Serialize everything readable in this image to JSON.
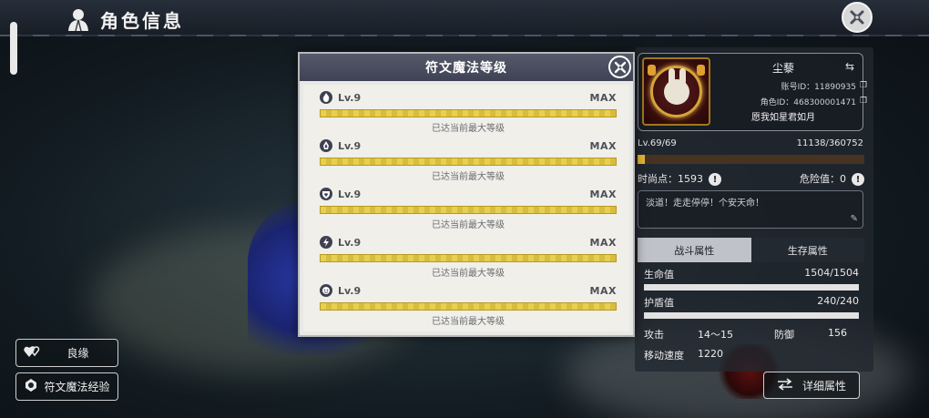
{
  "header": {
    "title": "角色信息"
  },
  "left_buttons": {
    "bond": "良缘",
    "rune_exp": "符文魔法经验"
  },
  "modal": {
    "title": "符文魔法等级",
    "runes": [
      {
        "level": "Lv.9",
        "max": "MAX",
        "progress": 1.0,
        "note": "已达当前最大等级",
        "icon": "flame-icon"
      },
      {
        "level": "Lv.9",
        "max": "MAX",
        "progress": 1.0,
        "note": "已达当前最大等级",
        "icon": "fire-icon"
      },
      {
        "level": "Lv.9",
        "max": "MAX",
        "progress": 1.0,
        "note": "已达当前最大等级",
        "icon": "heart-shield-icon"
      },
      {
        "level": "Lv.9",
        "max": "MAX",
        "progress": 1.0,
        "note": "已达当前最大等级",
        "icon": "lightning-icon"
      },
      {
        "level": "Lv.9",
        "max": "MAX",
        "progress": 1.0,
        "note": "已达当前最大等级",
        "icon": "face-icon"
      }
    ]
  },
  "profile": {
    "name": "尘藜",
    "account": "账号ID：11890935",
    "role_id": "角色ID：468300001471",
    "signature": "愿我如星君如月",
    "level": "Lv.69/69",
    "exp": "11138/360752",
    "exp_progress": 0.031,
    "fashion_label": "时尚点：1593",
    "danger_label": "危险值：0",
    "motto": "淡道！走走停停！个安天命！"
  },
  "tabs": {
    "combat": "战斗属性",
    "survival": "生存属性"
  },
  "attributes": {
    "hp_label": "生命值",
    "hp_value": "1504/1504",
    "hp_progress": 1.0,
    "shield_label": "护盾值",
    "shield_value": "240/240",
    "shield_progress": 1.0,
    "attack_label": "攻击",
    "attack_value": "14～15",
    "defense_label": "防御",
    "defense_value": "156",
    "speed_label": "移动速度",
    "speed_value": "1220"
  },
  "detail_button": "详细属性",
  "colors": {
    "gold": "#e6b634",
    "bar_gold": "#dcc44a",
    "modal_header": "#4a4e5e"
  }
}
